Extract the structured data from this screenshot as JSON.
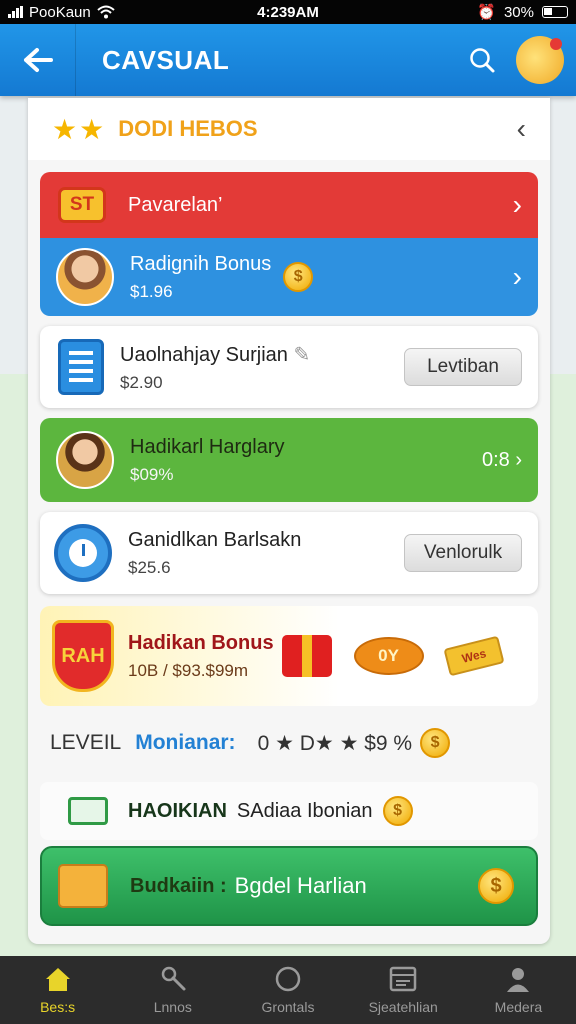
{
  "status_bar": {
    "carrier": "PooKaun",
    "time": "4:239AM",
    "battery": "30%"
  },
  "app_bar": {
    "title": "CAVSUAL"
  },
  "card": {
    "header_title": "DODI HEBOS",
    "rows": {
      "red": {
        "badge": "ST",
        "label": "Pavarelan’"
      },
      "blue": {
        "label": "Radignih Bonus",
        "value": "$1.96"
      },
      "white1": {
        "label": "Uaolnahjay Surjian",
        "value": "$2.90",
        "button": "Levtiban"
      },
      "green": {
        "label": "Hadikarl Harglary",
        "value": "$09%",
        "badge": "08",
        "trailing": "0:8"
      },
      "white2": {
        "label": "Ganidlkan Barlsakn",
        "value": "$25.6",
        "button": "Venlorulk"
      },
      "bonus": {
        "shield": "RAH",
        "label": "Hadikan Bonus",
        "value1": "10B",
        "value2": "/ $93.$99m",
        "tag": "0Y",
        "ticket": "Wes"
      }
    },
    "level": {
      "label": "LEVEIL",
      "name": "Monianar:",
      "value": "0 ★ D★ ★ $9 %"
    },
    "plain_row": {
      "bold": "HAOIKIAN",
      "label": "SAdiaa Ibonian"
    },
    "cta_row": {
      "bold": "Budkaiin :",
      "label": "Bgdel Harlian"
    }
  },
  "nav": [
    {
      "label": "Bes:s",
      "icon": "home-icon",
      "active": true
    },
    {
      "label": "Lnnos",
      "icon": "tools-icon",
      "active": false
    },
    {
      "label": "Grontals",
      "icon": "circle-icon",
      "active": false
    },
    {
      "label": "Sjeatehlian",
      "icon": "calendar-icon",
      "active": false
    },
    {
      "label": "Medera",
      "icon": "profile-icon",
      "active": false
    }
  ],
  "colors": {
    "app_bar": "#1f8fe5",
    "red_row": "#e33a37",
    "blue_row": "#2e91e0",
    "green_row": "#5cb63e",
    "cta_row": "#2aa457",
    "nav_bg": "#2c2c2c",
    "nav_active": "#e8d42a"
  }
}
